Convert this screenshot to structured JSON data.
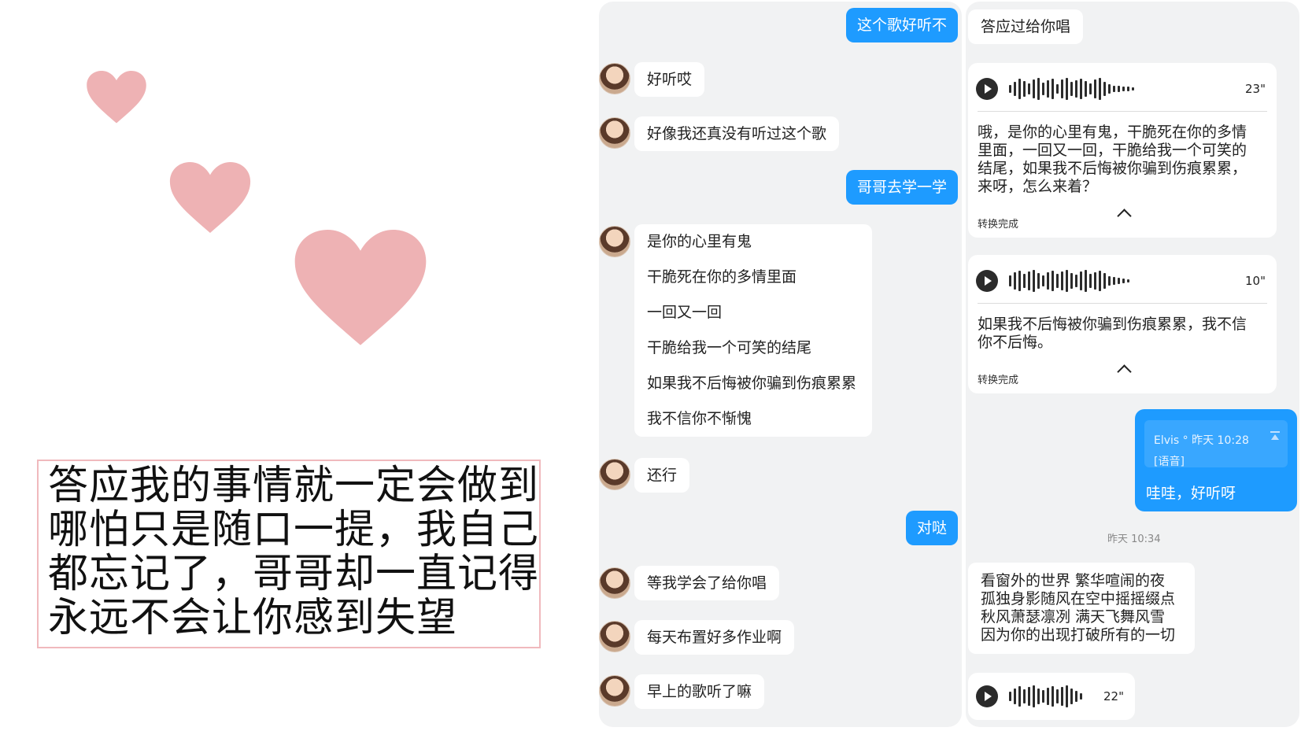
{
  "colors": {
    "heart": "#eeb2b4",
    "caption_border": "#f0b9bd",
    "panel_bg": "#f1f2f3",
    "outgoing_bubble": "#1e9bff",
    "incoming_bubble": "#ffffff"
  },
  "caption": {
    "lines": [
      "答应我的事情就一定会做到",
      "哪怕只是随口一提，我自己",
      "都忘记了，哥哥却一直记得",
      "永远不会让你感到失望"
    ]
  },
  "chat_left": {
    "messages": [
      {
        "from": "me",
        "text": "这个歌好听不"
      },
      {
        "from": "other",
        "text": "好听哎"
      },
      {
        "from": "other",
        "text": "好像我还真没有听过这个歌"
      },
      {
        "from": "me",
        "text": "哥哥去学一学"
      },
      {
        "from": "other",
        "lines": [
          "是你的心里有鬼",
          "干脆死在你的多情里面",
          "一回又一回",
          "干脆给我一个可笑的结尾",
          "如果我不后悔被你骗到伤痕累累",
          "我不信你不惭愧"
        ]
      },
      {
        "from": "other",
        "text": "还行"
      },
      {
        "from": "me",
        "text": "对哒"
      },
      {
        "from": "other",
        "text": "等我学会了给你唱"
      },
      {
        "from": "other",
        "text": "每天布置好多作业啊"
      },
      {
        "from": "other",
        "text": "早上的歌听了嘛"
      }
    ]
  },
  "chat_right": {
    "msg_top": "答应过给你唱",
    "voice1": {
      "duration": "23\"",
      "transcript": [
        "哦，是你的心里有鬼，干脆死在你的多情",
        "里面，一回又一回，干脆给我一个可笑的",
        "结尾，如果我不后悔被你骗到伤痕累累，",
        "来呀，怎么来着？"
      ],
      "status": "转换完成"
    },
    "voice2": {
      "duration": "10\"",
      "transcript": [
        "如果我不后悔被你骗到伤痕累累，我不信",
        "你不后悔。"
      ],
      "status": "转换完成"
    },
    "quote": {
      "meta": "Elvis ° 昨天 10:28",
      "tag": "[语音]",
      "reply": "哇哇，好听呀"
    },
    "time_separator": "昨天 10:34",
    "lyrics": [
      "看窗外的世界 繁华喧闹的夜",
      "孤独身影随风在空中摇摇缀点",
      "秋风萧瑟凛冽 满天飞舞风雪",
      "因为你的出现打破所有的一切"
    ],
    "voice3": {
      "duration": "22\""
    }
  }
}
